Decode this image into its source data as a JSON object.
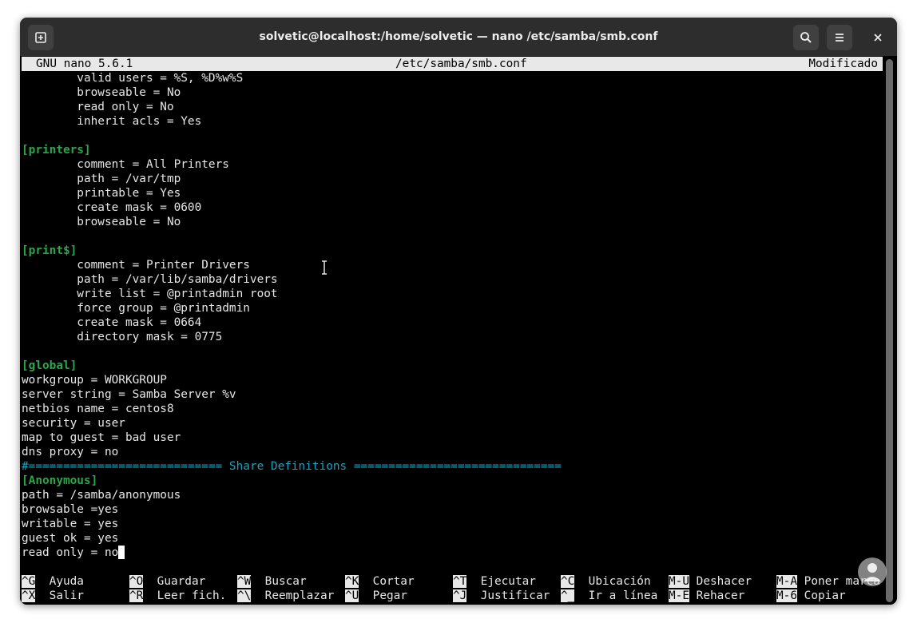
{
  "window": {
    "title": "solvetic@localhost:/home/solvetic — nano /etc/samba/smb.conf"
  },
  "nano": {
    "version": "GNU nano 5.6.1",
    "filename": "/etc/samba/smb.conf",
    "status": "Modificado"
  },
  "lines": [
    {
      "text": "        valid users = %S, %D%w%S",
      "style": "normal"
    },
    {
      "text": "        browseable = No",
      "style": "normal"
    },
    {
      "text": "        read only = No",
      "style": "normal"
    },
    {
      "text": "        inherit acls = Yes",
      "style": "normal"
    },
    {
      "text": "",
      "style": "normal"
    },
    {
      "text": "[printers]",
      "style": "section"
    },
    {
      "text": "        comment = All Printers",
      "style": "normal"
    },
    {
      "text": "        path = /var/tmp",
      "style": "normal"
    },
    {
      "text": "        printable = Yes",
      "style": "normal"
    },
    {
      "text": "        create mask = 0600",
      "style": "normal"
    },
    {
      "text": "        browseable = No",
      "style": "normal"
    },
    {
      "text": "",
      "style": "normal"
    },
    {
      "text": "[print$]",
      "style": "section"
    },
    {
      "text": "        comment = Printer Drivers",
      "style": "normal"
    },
    {
      "text": "        path = /var/lib/samba/drivers",
      "style": "normal"
    },
    {
      "text": "        write list = @printadmin root",
      "style": "normal"
    },
    {
      "text": "        force group = @printadmin",
      "style": "normal"
    },
    {
      "text": "        create mask = 0664",
      "style": "normal"
    },
    {
      "text": "        directory mask = 0775",
      "style": "normal"
    },
    {
      "text": "",
      "style": "normal"
    },
    {
      "text": "[global]",
      "style": "section"
    },
    {
      "text": "workgroup = WORKGROUP",
      "style": "normal"
    },
    {
      "text": "server string = Samba Server %v",
      "style": "normal"
    },
    {
      "text": "netbios name = centos8",
      "style": "normal"
    },
    {
      "text": "security = user",
      "style": "normal"
    },
    {
      "text": "map to guest = bad user",
      "style": "normal"
    },
    {
      "text": "dns proxy = no",
      "style": "normal"
    },
    {
      "text": "#============================ Share Definitions ==============================",
      "style": "comment"
    },
    {
      "text": "[Anonymous]",
      "style": "section"
    },
    {
      "text": "path = /samba/anonymous",
      "style": "normal"
    },
    {
      "text": "browsable =yes",
      "style": "normal"
    },
    {
      "text": "writable = yes",
      "style": "normal"
    },
    {
      "text": "guest ok = yes",
      "style": "normal"
    },
    {
      "text": "read only = no",
      "style": "normal",
      "cursor": true
    }
  ],
  "shortcuts": [
    [
      {
        "key": "^G",
        "label": "Ayuda"
      },
      {
        "key": "^O",
        "label": "Guardar"
      },
      {
        "key": "^W",
        "label": "Buscar"
      },
      {
        "key": "^K",
        "label": "Cortar"
      },
      {
        "key": "^T",
        "label": "Ejecutar"
      },
      {
        "key": "^C",
        "label": "Ubicación"
      },
      {
        "key": "M-U",
        "label": "Deshacer"
      },
      {
        "key": "M-A",
        "label": "Poner marca"
      }
    ],
    [
      {
        "key": "^X",
        "label": "Salir"
      },
      {
        "key": "^R",
        "label": "Leer fich."
      },
      {
        "key": "^\\",
        "label": "Reemplazar"
      },
      {
        "key": "^U",
        "label": "Pegar"
      },
      {
        "key": "^J",
        "label": "Justificar"
      },
      {
        "key": "^_",
        "label": "Ir a línea"
      },
      {
        "key": "M-E",
        "label": "Rehacer"
      },
      {
        "key": "M-6",
        "label": "Copiar"
      }
    ]
  ],
  "icons": {
    "new_tab": "new-tab-icon",
    "search": "search-icon",
    "menu": "hamburger-menu-icon",
    "close": "close-icon"
  },
  "colors": {
    "section": "#2aa64a",
    "comment": "#18a3bf",
    "titlebar": "#2d2d2d",
    "terminal_bg": "#000000",
    "terminal_fg": "#e6e6e6"
  }
}
